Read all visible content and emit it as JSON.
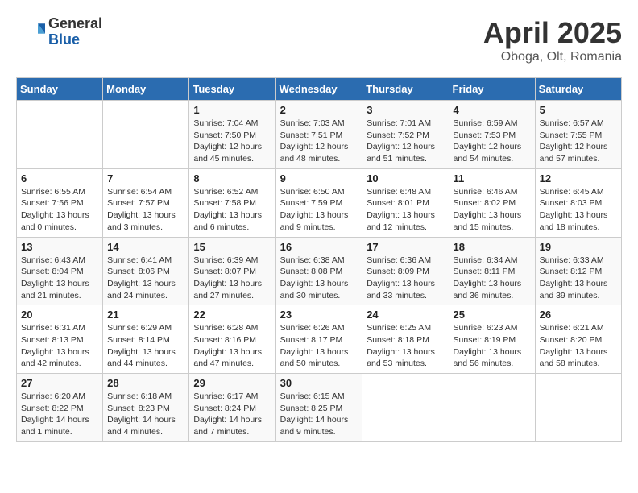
{
  "header": {
    "logo_general": "General",
    "logo_blue": "Blue",
    "month_title": "April 2025",
    "location": "Oboga, Olt, Romania"
  },
  "weekdays": [
    "Sunday",
    "Monday",
    "Tuesday",
    "Wednesday",
    "Thursday",
    "Friday",
    "Saturday"
  ],
  "weeks": [
    [
      {
        "day": "",
        "info": ""
      },
      {
        "day": "",
        "info": ""
      },
      {
        "day": "1",
        "info": "Sunrise: 7:04 AM\nSunset: 7:50 PM\nDaylight: 12 hours and 45 minutes."
      },
      {
        "day": "2",
        "info": "Sunrise: 7:03 AM\nSunset: 7:51 PM\nDaylight: 12 hours and 48 minutes."
      },
      {
        "day": "3",
        "info": "Sunrise: 7:01 AM\nSunset: 7:52 PM\nDaylight: 12 hours and 51 minutes."
      },
      {
        "day": "4",
        "info": "Sunrise: 6:59 AM\nSunset: 7:53 PM\nDaylight: 12 hours and 54 minutes."
      },
      {
        "day": "5",
        "info": "Sunrise: 6:57 AM\nSunset: 7:55 PM\nDaylight: 12 hours and 57 minutes."
      }
    ],
    [
      {
        "day": "6",
        "info": "Sunrise: 6:55 AM\nSunset: 7:56 PM\nDaylight: 13 hours and 0 minutes."
      },
      {
        "day": "7",
        "info": "Sunrise: 6:54 AM\nSunset: 7:57 PM\nDaylight: 13 hours and 3 minutes."
      },
      {
        "day": "8",
        "info": "Sunrise: 6:52 AM\nSunset: 7:58 PM\nDaylight: 13 hours and 6 minutes."
      },
      {
        "day": "9",
        "info": "Sunrise: 6:50 AM\nSunset: 7:59 PM\nDaylight: 13 hours and 9 minutes."
      },
      {
        "day": "10",
        "info": "Sunrise: 6:48 AM\nSunset: 8:01 PM\nDaylight: 13 hours and 12 minutes."
      },
      {
        "day": "11",
        "info": "Sunrise: 6:46 AM\nSunset: 8:02 PM\nDaylight: 13 hours and 15 minutes."
      },
      {
        "day": "12",
        "info": "Sunrise: 6:45 AM\nSunset: 8:03 PM\nDaylight: 13 hours and 18 minutes."
      }
    ],
    [
      {
        "day": "13",
        "info": "Sunrise: 6:43 AM\nSunset: 8:04 PM\nDaylight: 13 hours and 21 minutes."
      },
      {
        "day": "14",
        "info": "Sunrise: 6:41 AM\nSunset: 8:06 PM\nDaylight: 13 hours and 24 minutes."
      },
      {
        "day": "15",
        "info": "Sunrise: 6:39 AM\nSunset: 8:07 PM\nDaylight: 13 hours and 27 minutes."
      },
      {
        "day": "16",
        "info": "Sunrise: 6:38 AM\nSunset: 8:08 PM\nDaylight: 13 hours and 30 minutes."
      },
      {
        "day": "17",
        "info": "Sunrise: 6:36 AM\nSunset: 8:09 PM\nDaylight: 13 hours and 33 minutes."
      },
      {
        "day": "18",
        "info": "Sunrise: 6:34 AM\nSunset: 8:11 PM\nDaylight: 13 hours and 36 minutes."
      },
      {
        "day": "19",
        "info": "Sunrise: 6:33 AM\nSunset: 8:12 PM\nDaylight: 13 hours and 39 minutes."
      }
    ],
    [
      {
        "day": "20",
        "info": "Sunrise: 6:31 AM\nSunset: 8:13 PM\nDaylight: 13 hours and 42 minutes."
      },
      {
        "day": "21",
        "info": "Sunrise: 6:29 AM\nSunset: 8:14 PM\nDaylight: 13 hours and 44 minutes."
      },
      {
        "day": "22",
        "info": "Sunrise: 6:28 AM\nSunset: 8:16 PM\nDaylight: 13 hours and 47 minutes."
      },
      {
        "day": "23",
        "info": "Sunrise: 6:26 AM\nSunset: 8:17 PM\nDaylight: 13 hours and 50 minutes."
      },
      {
        "day": "24",
        "info": "Sunrise: 6:25 AM\nSunset: 8:18 PM\nDaylight: 13 hours and 53 minutes."
      },
      {
        "day": "25",
        "info": "Sunrise: 6:23 AM\nSunset: 8:19 PM\nDaylight: 13 hours and 56 minutes."
      },
      {
        "day": "26",
        "info": "Sunrise: 6:21 AM\nSunset: 8:20 PM\nDaylight: 13 hours and 58 minutes."
      }
    ],
    [
      {
        "day": "27",
        "info": "Sunrise: 6:20 AM\nSunset: 8:22 PM\nDaylight: 14 hours and 1 minute."
      },
      {
        "day": "28",
        "info": "Sunrise: 6:18 AM\nSunset: 8:23 PM\nDaylight: 14 hours and 4 minutes."
      },
      {
        "day": "29",
        "info": "Sunrise: 6:17 AM\nSunset: 8:24 PM\nDaylight: 14 hours and 7 minutes."
      },
      {
        "day": "30",
        "info": "Sunrise: 6:15 AM\nSunset: 8:25 PM\nDaylight: 14 hours and 9 minutes."
      },
      {
        "day": "",
        "info": ""
      },
      {
        "day": "",
        "info": ""
      },
      {
        "day": "",
        "info": ""
      }
    ]
  ]
}
